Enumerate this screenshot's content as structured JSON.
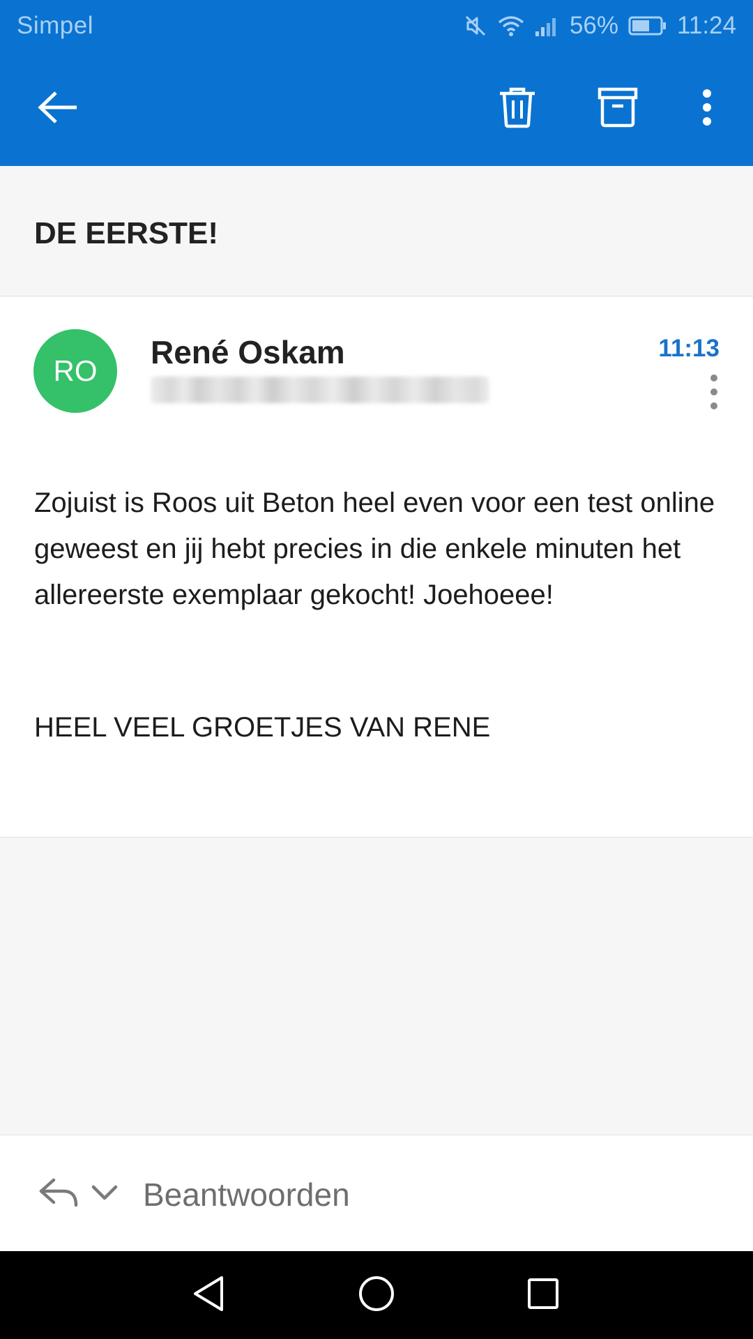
{
  "status_bar": {
    "carrier": "Simpel",
    "battery_percent": "56%",
    "time": "11:24",
    "icons": [
      "mute-icon",
      "wifi-icon",
      "signal-icon",
      "battery-icon"
    ]
  },
  "app_bar": {
    "icons": [
      "back-arrow-icon",
      "trash-icon",
      "archive-icon",
      "more-vert-icon"
    ]
  },
  "email": {
    "subject": "DE EERSTE!",
    "sender": {
      "initials": "RO",
      "name": "René Oskam",
      "avatar_color": "#35c06a"
    },
    "time": "11:13",
    "body": "Zojuist is Roos uit Beton heel even voor een test online geweest en jij hebt precies in die enkele minuten het allereerste exemplaar gekocht! Joehoeee!",
    "signature": "HEEL VEEL GROETJES VAN RENE"
  },
  "reply_bar": {
    "label": "Beantwoorden"
  },
  "colors": {
    "accent": "#0a73d1",
    "time_accent": "#1a73c8"
  }
}
